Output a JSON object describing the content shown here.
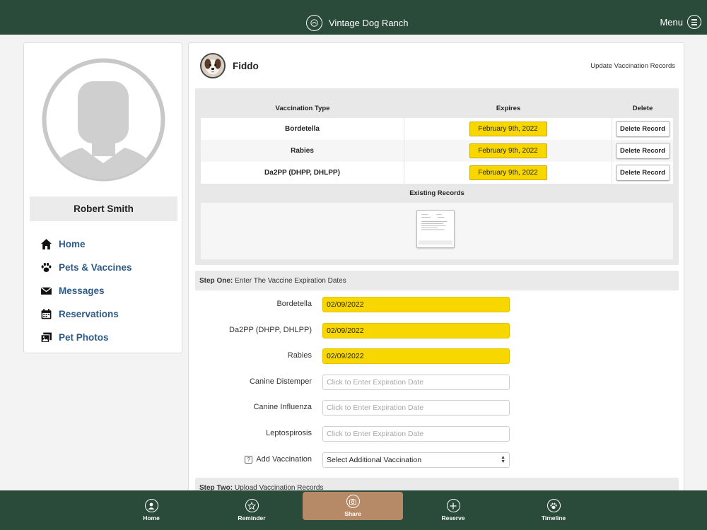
{
  "header": {
    "brand": "Vintage Dog Ranch",
    "menu_label": "Menu"
  },
  "profile": {
    "name": "Robert Smith",
    "nav": [
      {
        "label": "Home",
        "icon": "home-icon"
      },
      {
        "label": "Pets & Vaccines",
        "icon": "paw-icon"
      },
      {
        "label": "Messages",
        "icon": "envelope-icon"
      },
      {
        "label": "Reservations",
        "icon": "calendar-icon"
      },
      {
        "label": "Pet Photos",
        "icon": "photos-icon"
      }
    ]
  },
  "pet": {
    "name": "Fiddo",
    "update_link": "Update Vaccination Records"
  },
  "vaccination_table": {
    "headers": {
      "type": "Vaccination Type",
      "expires": "Expires",
      "delete": "Delete"
    },
    "rows": [
      {
        "type": "Bordetella",
        "expires": "February 9th, 2022",
        "action": "Delete Record"
      },
      {
        "type": "Rabies",
        "expires": "February 9th, 2022",
        "action": "Delete Record"
      },
      {
        "type": "Da2PP (DHPP, DHLPP)",
        "expires": "February 9th, 2022",
        "action": "Delete Record"
      }
    ],
    "existing_records_title": "Existing Records"
  },
  "step_one": {
    "label": "Step One:",
    "text": "Enter The Vaccine Expiration Dates",
    "fields": [
      {
        "label": "Bordetella",
        "value": "02/09/2022",
        "placeholder": ""
      },
      {
        "label": "Da2PP (DHPP, DHLPP)",
        "value": "02/09/2022",
        "placeholder": ""
      },
      {
        "label": "Rabies",
        "value": "02/09/2022",
        "placeholder": ""
      },
      {
        "label": "Canine Distemper",
        "value": "",
        "placeholder": "Click to Enter Expiration Date"
      },
      {
        "label": "Canine Influenza",
        "value": "",
        "placeholder": "Click to Enter Expiration Date"
      },
      {
        "label": "Leptospirosis",
        "value": "",
        "placeholder": "Click to Enter Expiration Date"
      }
    ],
    "add_vaccination": {
      "help": "?",
      "label": "Add Vaccination",
      "selected": "Select Additional Vaccination"
    }
  },
  "step_two": {
    "label": "Step Two:",
    "text": "Upload Vaccination Records"
  },
  "bottom_nav": {
    "tabs": [
      {
        "label": "Home",
        "icon": "person-icon"
      },
      {
        "label": "Reminder",
        "icon": "star-icon"
      },
      {
        "label": "Share",
        "icon": "camera-icon"
      },
      {
        "label": "Reserve",
        "icon": "plus-icon"
      },
      {
        "label": "Timeline",
        "icon": "paw-icon"
      }
    ],
    "active_index": 2
  },
  "colors": {
    "header_bg": "#2a4a3a",
    "highlight": "#f8d700",
    "active_tab": "#b68a66",
    "nav_link": "#2d5a86"
  }
}
